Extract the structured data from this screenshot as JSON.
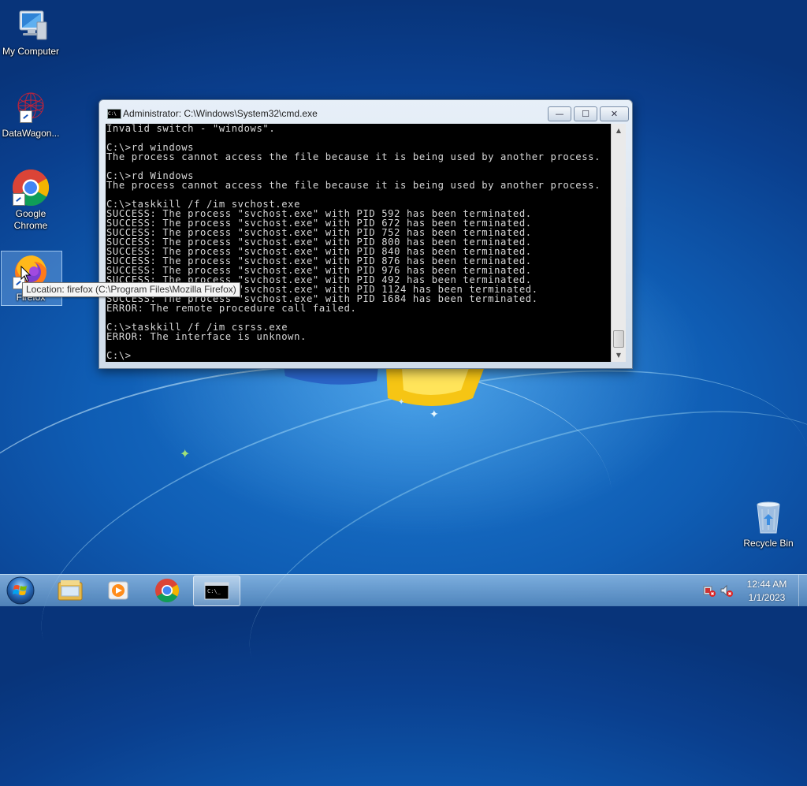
{
  "desktop": {
    "icons": [
      {
        "label": "My Computer",
        "icon": "computer-icon"
      },
      {
        "label": "DataWagon...",
        "icon": "datawagon-icon"
      },
      {
        "label_line1": "Google",
        "label_line2": "Chrome",
        "icon": "chrome-icon"
      },
      {
        "label": "Firefox",
        "icon": "firefox-icon"
      },
      {
        "label": "Recycle Bin",
        "icon": "recycle-bin-icon"
      }
    ]
  },
  "tooltip": {
    "text": "Location: firefox (C:\\Program Files\\Mozilla Firefox)"
  },
  "cmd_window": {
    "title": "Administrator: C:\\Windows\\System32\\cmd.exe",
    "title_icon_text": "C:\\",
    "buttons": {
      "minimize": "—",
      "maximize": "☐",
      "close": "✕"
    },
    "lines": [
      "Invalid switch - \"windows\".",
      "",
      "C:\\>rd windows",
      "The process cannot access the file because it is being used by another process.",
      "",
      "C:\\>rd Windows",
      "The process cannot access the file because it is being used by another process.",
      "",
      "C:\\>taskkill /f /im svchost.exe",
      "SUCCESS: The process \"svchost.exe\" with PID 592 has been terminated.",
      "SUCCESS: The process \"svchost.exe\" with PID 672 has been terminated.",
      "SUCCESS: The process \"svchost.exe\" with PID 752 has been terminated.",
      "SUCCESS: The process \"svchost.exe\" with PID 800 has been terminated.",
      "SUCCESS: The process \"svchost.exe\" with PID 840 has been terminated.",
      "SUCCESS: The process \"svchost.exe\" with PID 876 has been terminated.",
      "SUCCESS: The process \"svchost.exe\" with PID 976 has been terminated.",
      "SUCCESS: The process \"svchost.exe\" with PID 492 has been terminated.",
      "SUCCESS: The process \"svchost.exe\" with PID 1124 has been terminated.",
      "SUCCESS: The process \"svchost.exe\" with PID 1684 has been terminated.",
      "ERROR: The remote procedure call failed.",
      "",
      "C:\\>taskkill /f /im csrss.exe",
      "ERROR: The interface is unknown.",
      "",
      "C:\\>"
    ]
  },
  "taskbar": {
    "start": "start-orb-icon",
    "pinned": [
      "explorer-icon",
      "media-player-icon",
      "chrome-icon",
      "cmd-icon"
    ],
    "active_item": "cmd-icon",
    "tray": [
      "action-center-flag-icon",
      "volume-muted-icon"
    ],
    "clock": {
      "time": "12:44 AM",
      "date": "1/1/2023"
    }
  },
  "colors": {
    "console_bg": "#000000",
    "console_text": "#d8d8d8",
    "desktop_blue": "#0f5db4"
  }
}
